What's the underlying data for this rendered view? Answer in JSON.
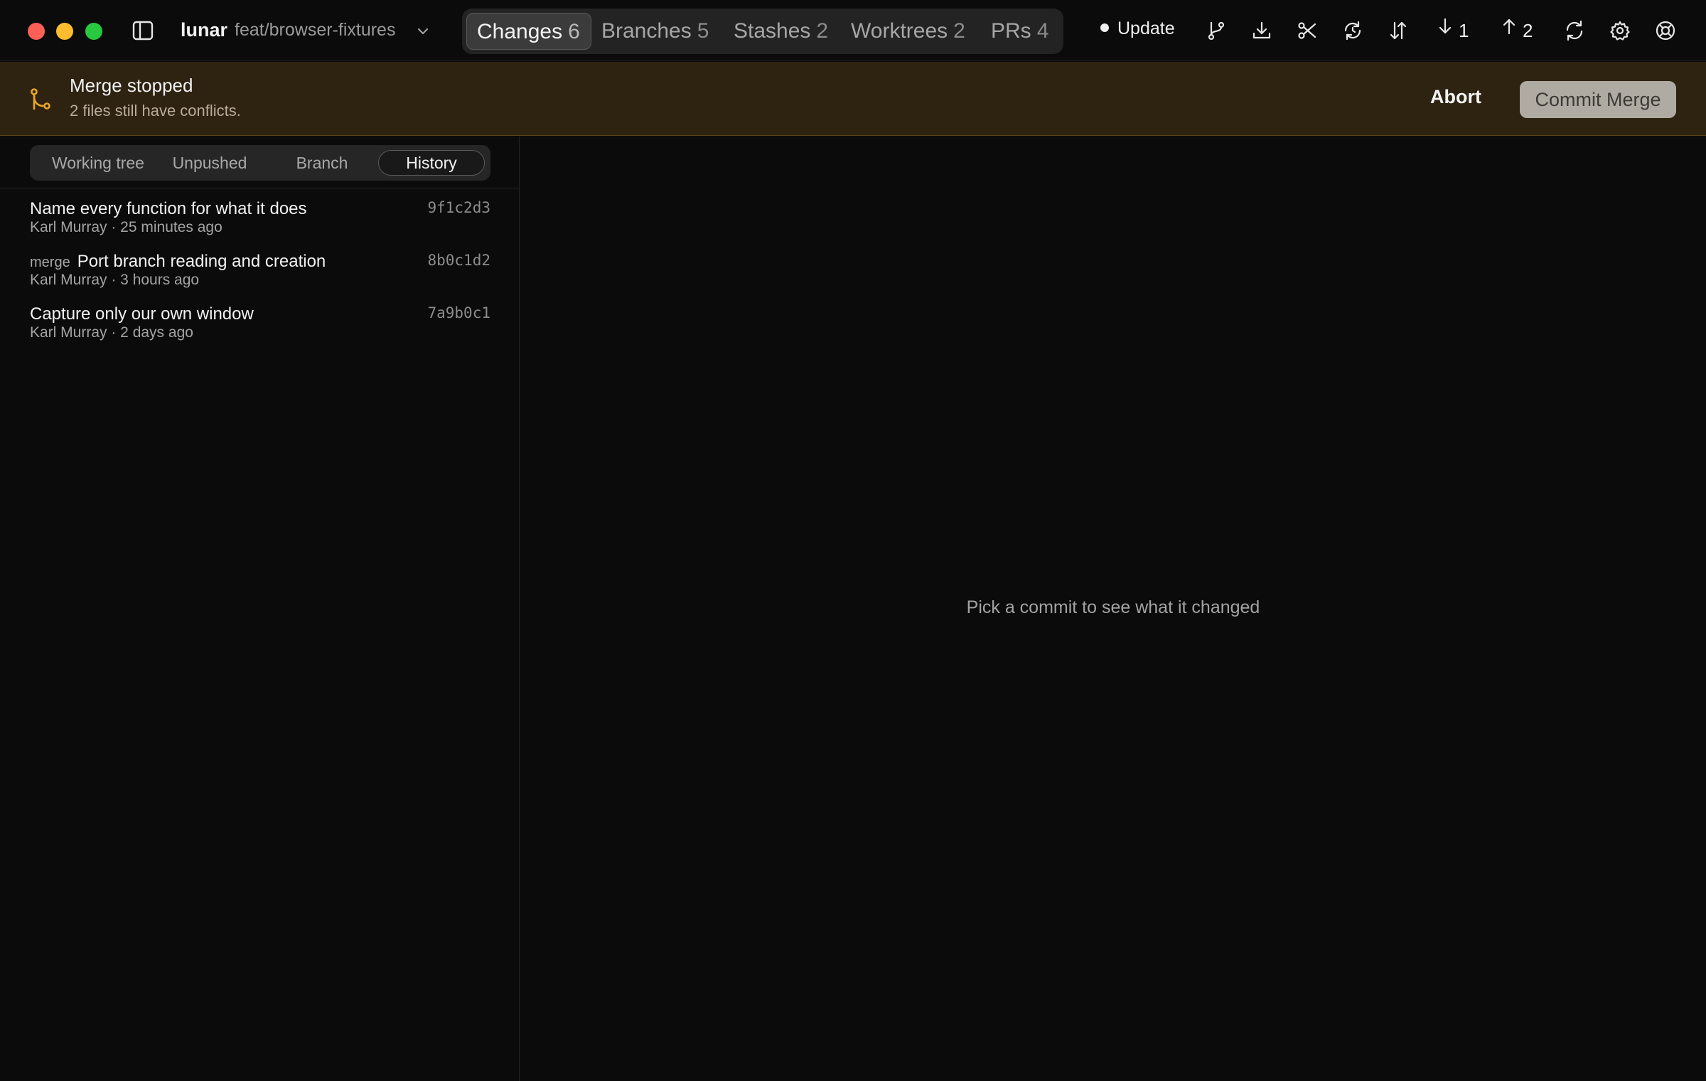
{
  "window": {
    "repo": "lunar",
    "branch": "feat/browser-fixtures"
  },
  "tabs": [
    {
      "label": "Changes",
      "count": "6",
      "active": true
    },
    {
      "label": "Branches",
      "count": "5"
    },
    {
      "label": "Stashes",
      "count": "2"
    },
    {
      "label": "Worktrees",
      "count": "2"
    },
    {
      "label": "PRs",
      "count": "4"
    }
  ],
  "toolbar": {
    "update_label": "Update",
    "pull_count": "1",
    "push_count": "2",
    "icons": [
      "branch-icon",
      "download-icon",
      "scissors-icon",
      "history-refresh-icon",
      "sort-arrows-icon",
      "arrow-down-icon",
      "arrow-up-icon",
      "sync-icon",
      "gear-icon",
      "help-lifebuoy-icon"
    ]
  },
  "banner": {
    "title": "Merge stopped",
    "subtitle": "2 files still have conflicts.",
    "abort_label": "Abort",
    "commit_label": "Commit Merge",
    "accent": "#e8a628",
    "background": "#2e2211"
  },
  "segments": [
    {
      "label": "Working tree"
    },
    {
      "label": "Unpushed"
    },
    {
      "label": "Branch"
    },
    {
      "label": "History",
      "active": true
    }
  ],
  "commits": [
    {
      "title": "Name every function for what it does",
      "tag": "",
      "author": "Karl Murray",
      "time": "25 minutes ago",
      "meta": "Karl Murray · 25 minutes ago",
      "sha": "9f1c2d3"
    },
    {
      "title": "Port branch reading and creation",
      "tag": "merge",
      "author": "Karl Murray",
      "time": "3 hours ago",
      "meta": "Karl Murray · 3 hours ago",
      "sha": "8b0c1d2"
    },
    {
      "title": "Capture only our own window",
      "tag": "",
      "author": "Karl Murray",
      "time": "2 days ago",
      "meta": "Karl Murray · 2 days ago",
      "sha": "7a9b0c1"
    }
  ],
  "detail": {
    "empty_message": "Pick a commit to see what it changed"
  }
}
